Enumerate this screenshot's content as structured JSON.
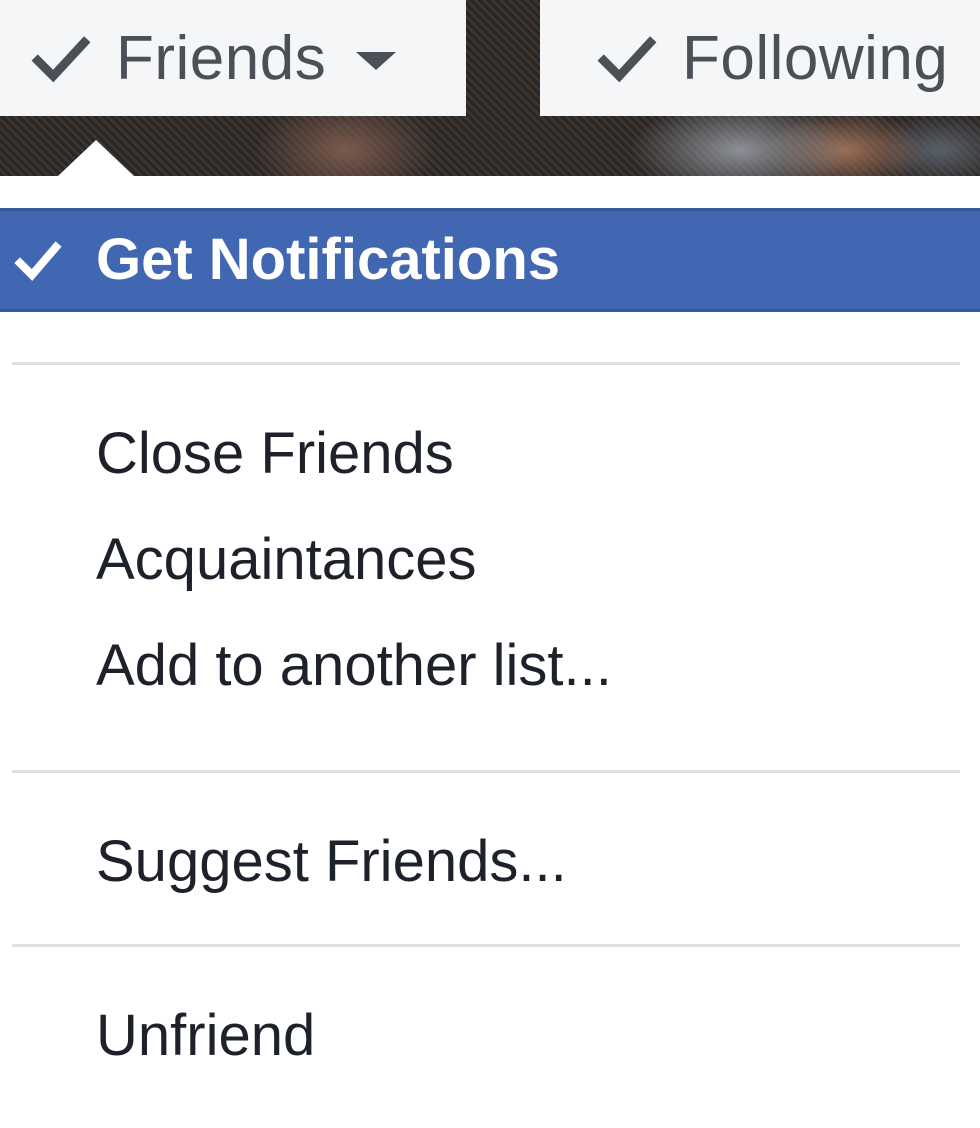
{
  "buttons": {
    "friends_label": "Friends",
    "following_label": "Following",
    "check_icon": "check-icon",
    "caret_icon": "caret-down-icon"
  },
  "menu": {
    "get_notifications": {
      "label": "Get Notifications",
      "checked": true,
      "icon": "check-icon"
    },
    "close_friends": "Close Friends",
    "acquaintances": "Acquaintances",
    "add_to_list": "Add to another list...",
    "suggest_friends": "Suggest Friends...",
    "unfriend": "Unfriend"
  },
  "colors": {
    "highlight": "#4267b2",
    "button_bg": "#f5f6f8",
    "button_text": "#4b4f56",
    "menu_text": "#1d2129",
    "divider": "#dddfe2"
  }
}
